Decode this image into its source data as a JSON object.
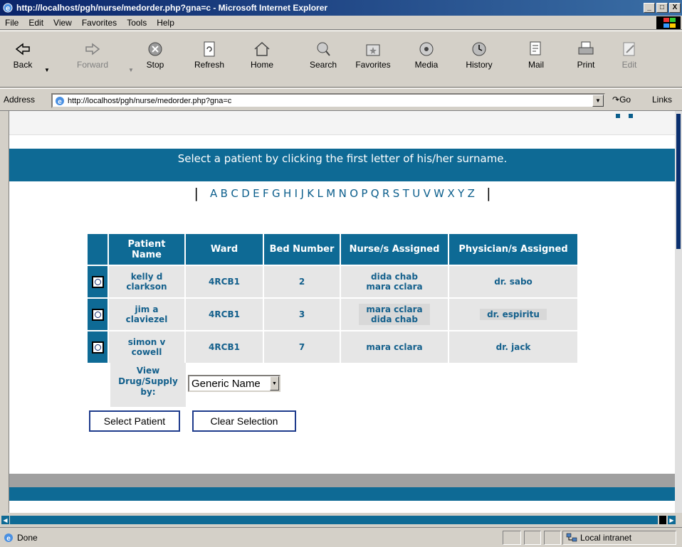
{
  "window": {
    "title": "http://localhost/pgh/nurse/medorder.php?gna=c - Microsoft Internet Explorer",
    "min_label": "_",
    "max_label": "□",
    "close_label": "X"
  },
  "menu": [
    "File",
    "Edit",
    "View",
    "Favorites",
    "Tools",
    "Help"
  ],
  "toolbar": {
    "back": "Back",
    "forward": "Forward",
    "stop": "Stop",
    "refresh": "Refresh",
    "home": "Home",
    "search": "Search",
    "favorites": "Favorites",
    "media": "Media",
    "history": "History",
    "mail": "Mail",
    "print": "Print",
    "edit": "Edit"
  },
  "address": {
    "label": "Address",
    "url": "http://localhost/pgh/nurse/medorder.php?gna=c",
    "go": "Go",
    "links": "Links"
  },
  "page": {
    "instruction": "Select a patient by clicking the first letter of his/her surname.",
    "letters": [
      "A",
      "B",
      "C",
      "D",
      "E",
      "F",
      "G",
      "H",
      "I",
      "J",
      "K",
      "L",
      "M",
      "N",
      "O",
      "P",
      "Q",
      "R",
      "S",
      "T",
      "U",
      "V",
      "W",
      "X",
      "Y",
      "Z"
    ],
    "columns": [
      "Patient Name",
      "Ward",
      "Bed Number",
      "Nurse/s Assigned",
      "Physician/s Assigned"
    ],
    "patients": [
      {
        "name_line1": "kelly  d",
        "name_line2": "clarkson",
        "ward": "4RCB1",
        "bed": "2",
        "nurse_line1": "dida chab",
        "nurse_line2": "mara cclara",
        "physician": "dr. sabo"
      },
      {
        "name_line1": "jim  a",
        "name_line2": "claviezel",
        "ward": "4RCB1",
        "bed": "3",
        "nurse_line1": "mara cclara",
        "nurse_line2": "dida chab",
        "physician": "dr. espiritu"
      },
      {
        "name_line1": "simon  v",
        "name_line2": "cowell",
        "ward": "4RCB1",
        "bed": "7",
        "nurse_line1": "mara cclara",
        "nurse_line2": "",
        "physician": "dr. jack"
      }
    ],
    "view_label_1": "View",
    "view_label_2": "Drug/Supply",
    "view_label_3": "by:",
    "view_select_value": "Generic Name",
    "select_patient": "Select Patient",
    "clear_selection": "Clear Selection"
  },
  "status": {
    "text": "Done",
    "zone": "Local intranet"
  }
}
